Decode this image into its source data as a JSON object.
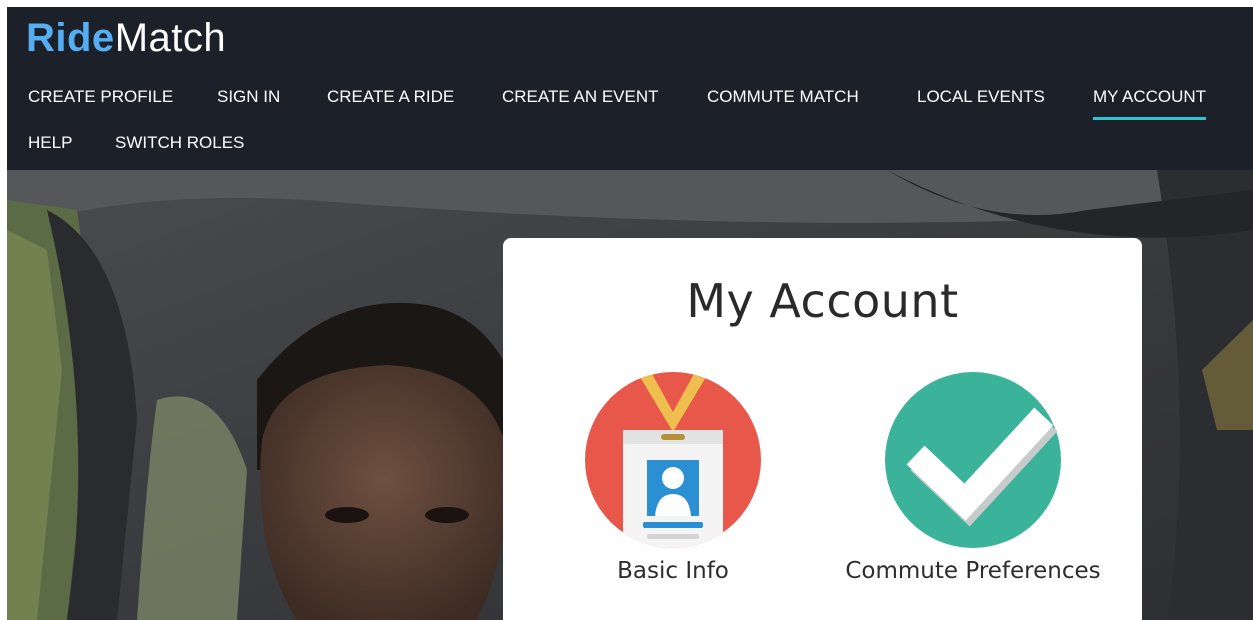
{
  "brand": {
    "part1": "Ride",
    "part2": "Match"
  },
  "nav": {
    "items": [
      {
        "label": "CREATE PROFILE"
      },
      {
        "label": "SIGN IN"
      },
      {
        "label": "CREATE A RIDE"
      },
      {
        "label": "CREATE AN EVENT"
      },
      {
        "label": "COMMUTE MATCH"
      },
      {
        "label": "LOCAL EVENTS"
      },
      {
        "label": "MY ACCOUNT",
        "active": true
      },
      {
        "label": "HELP"
      },
      {
        "label": "SWITCH ROLES"
      }
    ]
  },
  "card": {
    "title": "My Account",
    "tiles": [
      {
        "label": "Basic Info",
        "icon": "id-badge-icon"
      },
      {
        "label": "Commute Preferences",
        "icon": "checkmark-icon"
      }
    ]
  },
  "colors": {
    "header_bg": "#1c2029",
    "brand_accent": "#55aef2",
    "active_underline": "#2fc3d3",
    "badge_circle": "#e8584a",
    "check_circle": "#3bb39a"
  }
}
